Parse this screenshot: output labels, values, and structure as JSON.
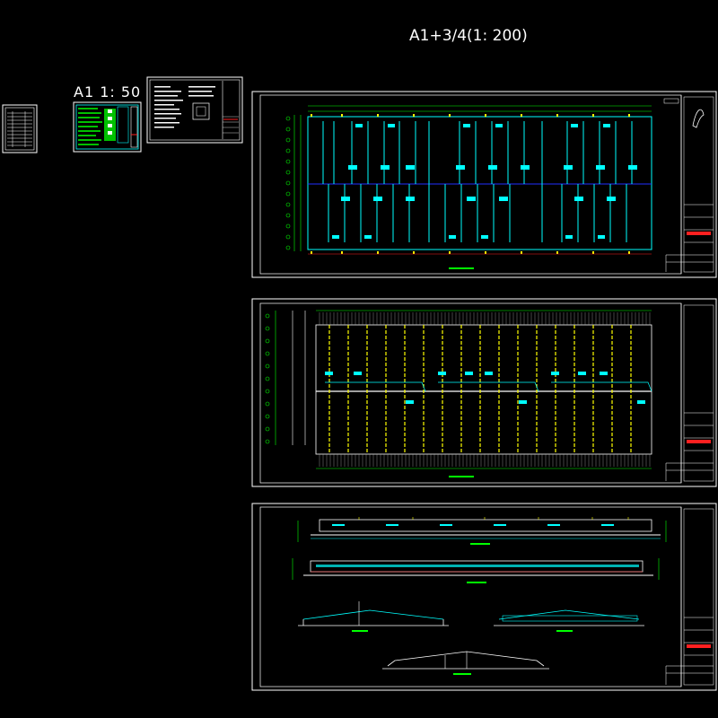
{
  "labels": {
    "main_scale": "A1+3/4(1: 200)",
    "a1_scale": "A1  1: 50"
  },
  "colors": {
    "background": "#000000",
    "frame": "#ffffff",
    "grid_line": "#00ffff",
    "axis_green": "#00ff00",
    "beam_yellow": "#ffff00",
    "highlight_blue": "#2030ff",
    "stamp_red": "#ff2020",
    "notes_green": "#00c000"
  },
  "sheets": [
    {
      "id": "cover-index",
      "title": ""
    },
    {
      "id": "design-notes",
      "title": ""
    },
    {
      "id": "general-notes",
      "title": ""
    },
    {
      "id": "foundation-plan",
      "title": ""
    },
    {
      "id": "roof-framing-plan",
      "title": ""
    },
    {
      "id": "elevations-sections",
      "title": ""
    }
  ]
}
